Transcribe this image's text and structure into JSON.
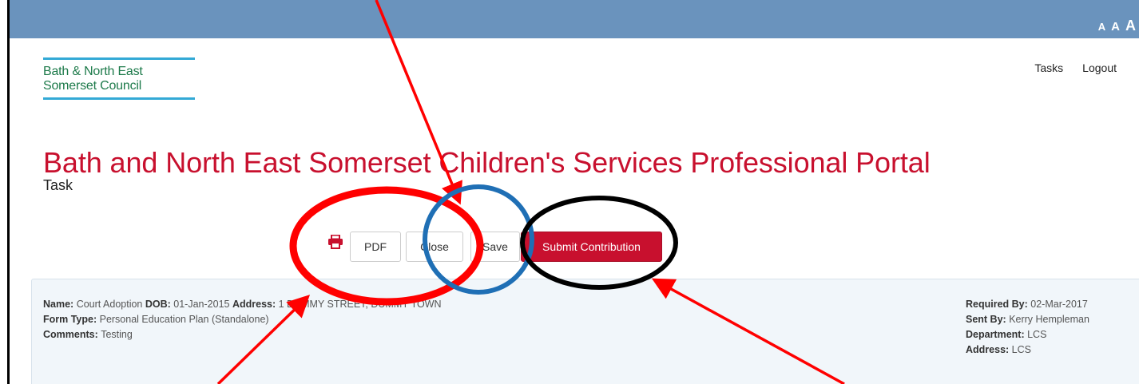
{
  "header": {
    "text_size": [
      "A",
      "A",
      "A"
    ],
    "nav": [
      "Tasks",
      "Logout"
    ]
  },
  "logo": {
    "line1": "Bath & North East",
    "line2": "Somerset Council"
  },
  "page": {
    "title": "Bath and North East Somerset Children's Services Professional Portal",
    "subtitle": "Task"
  },
  "toolbar": {
    "pdf_label": "PDF",
    "close_label": "Close",
    "save_label": "Save",
    "submit_label": "Submit Contribution"
  },
  "details": {
    "left": [
      [
        [
          "Name:",
          "Court Adoption"
        ],
        [
          "DOB:",
          "01-Jan-2015"
        ],
        [
          "Address:",
          "1 DUMMY STREET, DUMMY TOWN"
        ]
      ],
      [
        [
          "Form Type:",
          "Personal Education Plan (Standalone)"
        ]
      ],
      [
        [
          "Comments:",
          "Testing"
        ]
      ]
    ],
    "right": [
      [
        [
          "Required By:",
          "02-Mar-2017"
        ]
      ],
      [
        [
          "Sent By:",
          "Kerry Hempleman"
        ]
      ],
      [
        [
          "Department:",
          "LCS"
        ]
      ],
      [
        [
          "Address:",
          "LCS"
        ]
      ]
    ]
  },
  "annotations": {
    "colors": {
      "arrows": "#ff0000",
      "red_ellipse": "#ff0000",
      "blue_ellipse": "#1f6fb5",
      "black_ellipse": "#000000"
    }
  },
  "colors": {
    "topbar": "#6a93bd",
    "brand_red": "#c8102e",
    "logo_green": "#1d7a4a",
    "logo_rule": "#33a9d6"
  }
}
